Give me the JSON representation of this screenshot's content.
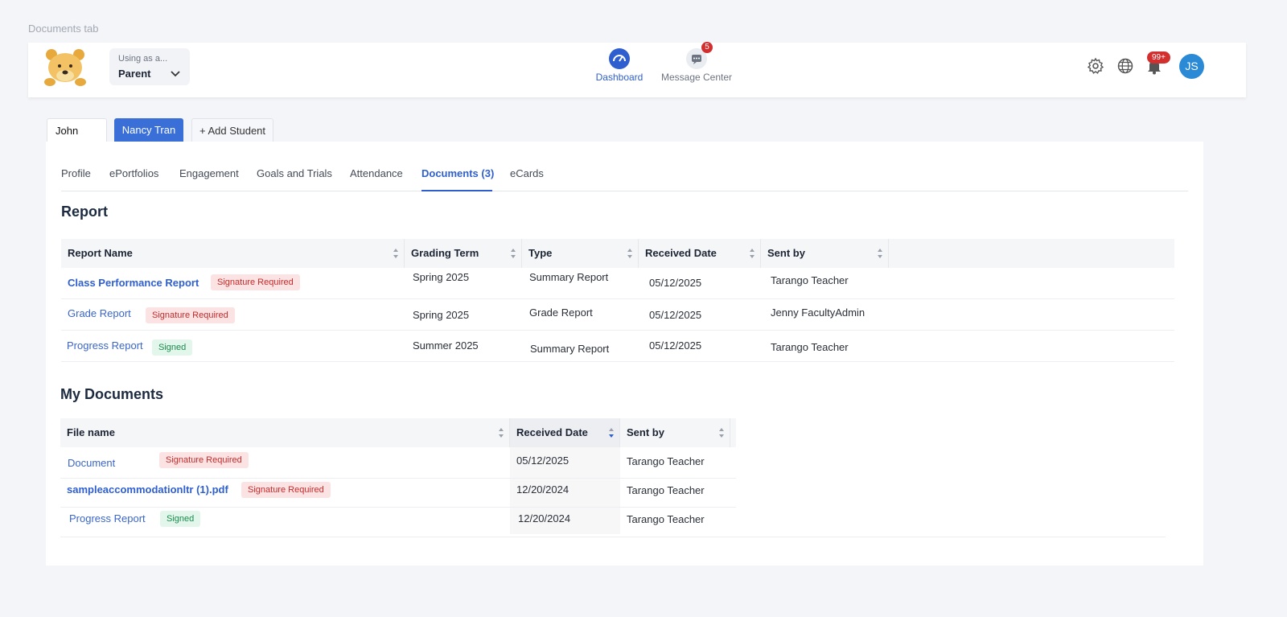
{
  "caption": "Documents tab",
  "header": {
    "role_hint": "Using as a...",
    "role_value": "Parent",
    "nav": [
      {
        "label": "Dashboard",
        "icon": "dashboard-icon"
      },
      {
        "label": "Message Center",
        "icon": "message-icon",
        "badge": "5"
      }
    ],
    "notifications_badge": "99+",
    "avatar_initials": "JS"
  },
  "students": {
    "tabs": [
      "John Tran",
      "Nancy Tran"
    ],
    "add_label": "+ Add Student"
  },
  "subtabs": [
    "Profile",
    "ePortfolios",
    "Engagement",
    "Goals and Trials",
    "Attendance",
    "Documents (3)",
    "eCards"
  ],
  "report": {
    "title": "Report",
    "columns": [
      "Report Name",
      "Grading Term",
      "Type",
      "Received Date",
      "Sent by"
    ],
    "rows": [
      {
        "name": "Class Performance Report",
        "status": "Signature Required",
        "term": "Spring 2025",
        "type": "Summary Report",
        "date": "05/12/2025",
        "sent_by": "Tarango Teacher"
      },
      {
        "name": "Grade Report",
        "status": "Signature Required",
        "term": "Spring 2025",
        "type": "Grade Report",
        "date": "05/12/2025",
        "sent_by": "Jenny FacultyAdmin"
      },
      {
        "name": "Progress Report",
        "status": "Signed",
        "term": "Summer 2025",
        "type": "Summary Report",
        "date": "05/12/2025",
        "sent_by": "Tarango Teacher"
      }
    ]
  },
  "my_documents": {
    "title": "My Documents",
    "columns": [
      "File name",
      "Received Date",
      "Sent by"
    ],
    "rows": [
      {
        "name": "Document",
        "status": "Signature Required",
        "date": "05/12/2025",
        "sent_by": "Tarango Teacher"
      },
      {
        "name": "sampleaccommodationltr (1).pdf",
        "status": "Signature Required",
        "date": "12/20/2024",
        "sent_by": "Tarango Teacher"
      },
      {
        "name": "Progress Report",
        "status": "Signed",
        "date": "12/20/2024",
        "sent_by": "Tarango Teacher"
      }
    ]
  },
  "colors": {
    "accent": "#2f5fce",
    "danger": "#c62b2b",
    "success": "#1a8b4c",
    "avatar": "#2a8ad6"
  }
}
